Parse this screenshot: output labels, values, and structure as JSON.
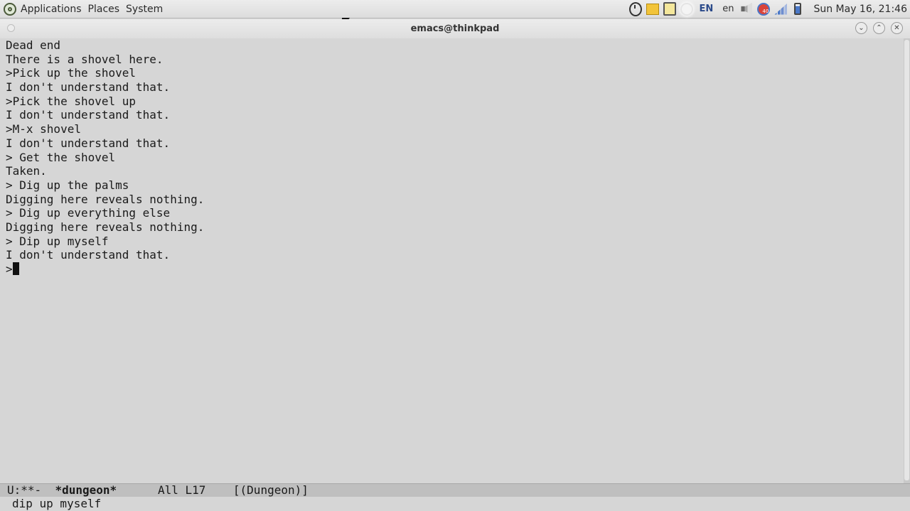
{
  "panel": {
    "menu_items": [
      "Applications",
      "Places",
      "System"
    ],
    "tray": {
      "icons": [
        "clock-icon",
        "mail-icon",
        "monitor-icon",
        "brightness-icon",
        "keyboard-layout-icon",
        "language-icon",
        "volume-icon",
        "notification-icon",
        "network-signal-icon",
        "battery-icon"
      ],
      "keyboard_layout": "EN",
      "language": "en",
      "notification_count": "40",
      "datetime": "Sun May 16, 21:46"
    }
  },
  "window": {
    "title": "emacs@thinkpad"
  },
  "buffer": {
    "lines": [
      "Dead end",
      "There is a shovel here.",
      ">Pick up the shovel",
      "I don't understand that.",
      ">Pick the shovel up",
      "I don't understand that.",
      ">M-x shovel",
      "I don't understand that.",
      "> Get the shovel",
      "Taken.",
      "> Dig up the palms",
      "Digging here reveals nothing.",
      "> Dig up everything else",
      "Digging here reveals nothing.",
      "> Dip up myself",
      "I don't understand that."
    ],
    "prompt": ">"
  },
  "modeline": {
    "status": "U:**-",
    "buffer_name": "*dungeon*",
    "position": "All L17",
    "mode": "[(Dungeon)]"
  },
  "minibuffer": {
    "text": "dip up myself"
  },
  "colors": {
    "background": "#d6d6d6",
    "modeline": "#bfbfbf",
    "text": "#1a1a1a"
  }
}
